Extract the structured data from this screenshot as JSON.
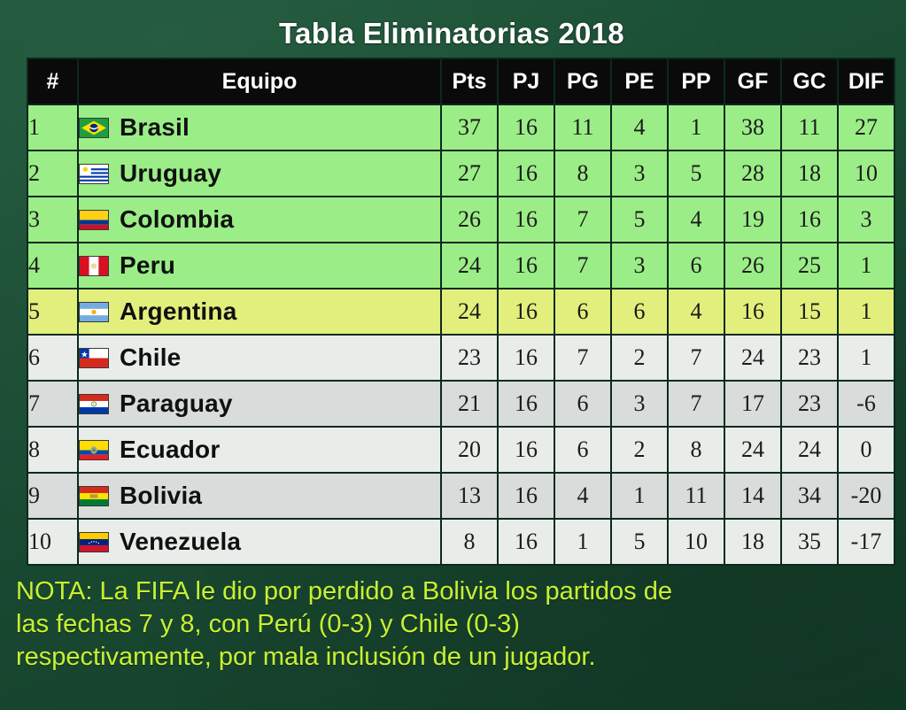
{
  "title": "Tabla Eliminatorias 2018",
  "colors": {
    "background": "#1a4b33",
    "title_text": "#ffffff",
    "header_bg": "#0a0a0a",
    "qualified_row": "#9bee87",
    "playoff_row": "#e2ef7c",
    "row_light": "#e9edea",
    "row_dark": "#d8dcda",
    "note_text": "#c8f032"
  },
  "table": {
    "headers": {
      "rank": "#",
      "team": "Equipo",
      "pts": "Pts",
      "pj": "PJ",
      "pg": "PG",
      "pe": "PE",
      "pp": "PP",
      "gf": "GF",
      "gc": "GC",
      "dif": "DIF"
    },
    "rows": [
      {
        "rank": "1",
        "team": "Brasil",
        "flag": "flag-brazil",
        "pts": "37",
        "pj": "16",
        "pg": "11",
        "pe": "4",
        "pp": "1",
        "gf": "38",
        "gc": "11",
        "dif": "27",
        "tier": "tier-q"
      },
      {
        "rank": "2",
        "team": "Uruguay",
        "flag": "flag-uruguay",
        "pts": "27",
        "pj": "16",
        "pg": "8",
        "pe": "3",
        "pp": "5",
        "gf": "28",
        "gc": "18",
        "dif": "10",
        "tier": "tier-q"
      },
      {
        "rank": "3",
        "team": "Colombia",
        "flag": "flag-colombia",
        "pts": "26",
        "pj": "16",
        "pg": "7",
        "pe": "5",
        "pp": "4",
        "gf": "19",
        "gc": "16",
        "dif": "3",
        "tier": "tier-q"
      },
      {
        "rank": "4",
        "team": "Peru",
        "flag": "flag-peru",
        "pts": "24",
        "pj": "16",
        "pg": "7",
        "pe": "3",
        "pp": "6",
        "gf": "26",
        "gc": "25",
        "dif": "1",
        "tier": "tier-q"
      },
      {
        "rank": "5",
        "team": "Argentina",
        "flag": "flag-argentina",
        "pts": "24",
        "pj": "16",
        "pg": "6",
        "pe": "6",
        "pp": "4",
        "gf": "16",
        "gc": "15",
        "dif": "1",
        "tier": "tier-po"
      },
      {
        "rank": "6",
        "team": "Chile",
        "flag": "flag-chile",
        "pts": "23",
        "pj": "16",
        "pg": "7",
        "pe": "2",
        "pp": "7",
        "gf": "24",
        "gc": "23",
        "dif": "1",
        "tier": "tier-a"
      },
      {
        "rank": "7",
        "team": "Paraguay",
        "flag": "flag-paraguay",
        "pts": "21",
        "pj": "16",
        "pg": "6",
        "pe": "3",
        "pp": "7",
        "gf": "17",
        "gc": "23",
        "dif": "-6",
        "tier": "tier-b"
      },
      {
        "rank": "8",
        "team": "Ecuador",
        "flag": "flag-ecuador",
        "pts": "20",
        "pj": "16",
        "pg": "6",
        "pe": "2",
        "pp": "8",
        "gf": "24",
        "gc": "24",
        "dif": "0",
        "tier": "tier-a"
      },
      {
        "rank": "9",
        "team": "Bolivia",
        "flag": "flag-bolivia",
        "pts": "13",
        "pj": "16",
        "pg": "4",
        "pe": "1",
        "pp": "11",
        "gf": "14",
        "gc": "34",
        "dif": "-20",
        "tier": "tier-b"
      },
      {
        "rank": "10",
        "team": "Venezuela",
        "flag": "flag-venezuela",
        "pts": "8",
        "pj": "16",
        "pg": "1",
        "pe": "5",
        "pp": "10",
        "gf": "18",
        "gc": "35",
        "dif": "-17",
        "tier": "tier-a"
      }
    ]
  },
  "note": {
    "line1": "NOTA: La FIFA le dio por perdido a Bolivia los partidos de",
    "line2": "las fechas 7 y 8, con Perú (0-3) y Chile (0-3)",
    "line3": "respectivamente, por mala inclusión de un jugador."
  }
}
